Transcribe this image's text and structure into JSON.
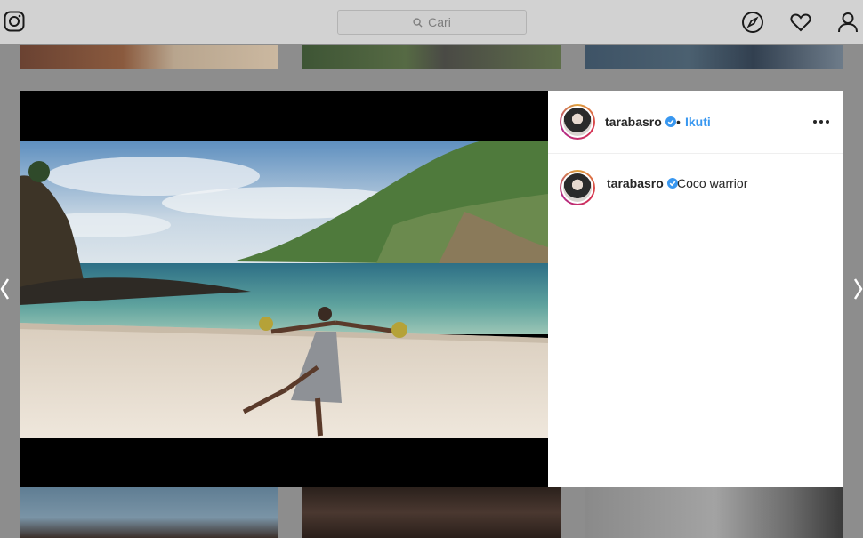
{
  "header": {
    "search_placeholder": "Cari",
    "icons": [
      "instagram-logo-icon",
      "search-icon",
      "compass-icon",
      "heart-icon",
      "profile-icon"
    ]
  },
  "post": {
    "username": "tarabasro",
    "verified": true,
    "separator": "•",
    "follow_label": "Ikuti",
    "caption_username": "tarabasro",
    "caption_text": "Coco warrior"
  },
  "colors": {
    "follow_blue": "#3897f0",
    "verified_blue": "#3897f0",
    "overlay": "#8d8d8d"
  }
}
